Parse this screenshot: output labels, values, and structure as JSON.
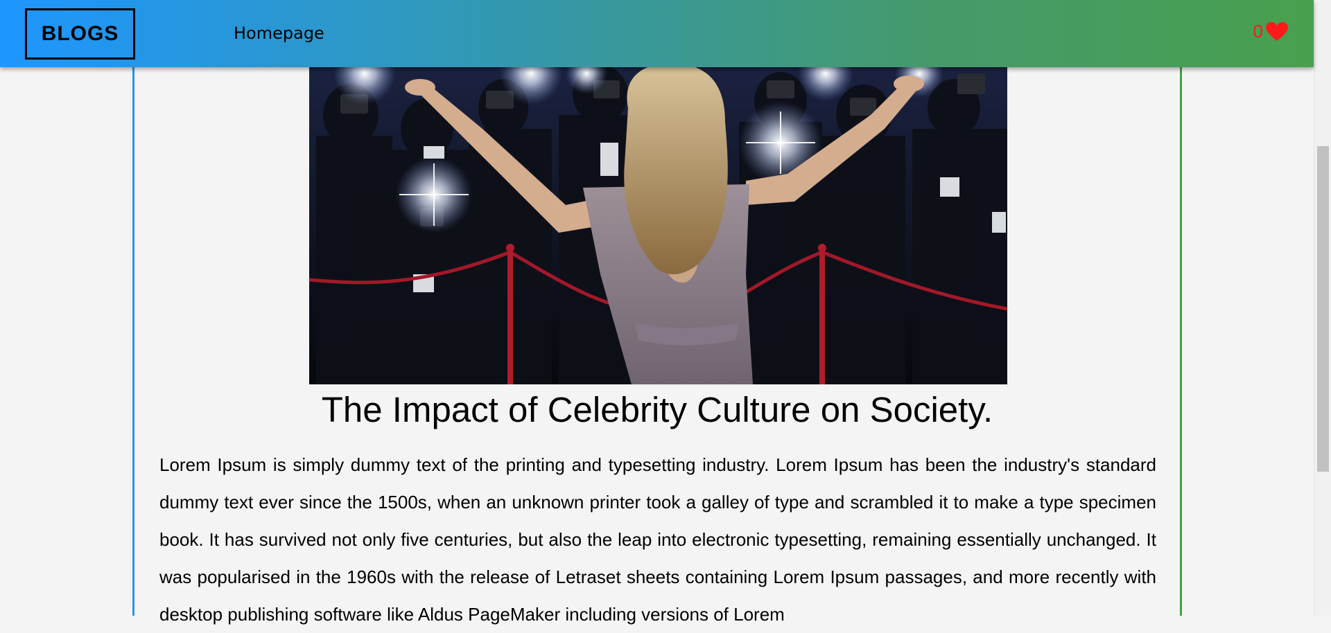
{
  "header": {
    "logo": "BLOGS",
    "nav": [
      {
        "label": "Homepage"
      }
    ],
    "likes_count": "0",
    "accent_gradient": [
      "#1e96ff",
      "#48a04e"
    ],
    "heart_color": "#ff1a1a"
  },
  "article": {
    "image_icon": "celebrity-red-carpet-photo",
    "title": "The Impact of Celebrity Culture on Society.",
    "body": "Lorem Ipsum is simply dummy text of the printing and typesetting industry. Lorem Ipsum has been the industry's standard dummy text ever since the 1500s, when an unknown printer took a galley of type and scrambled it to make a type specimen book. It has survived not only five centuries, but also the leap into electronic typesetting, remaining essentially unchanged. It was popularised in the 1960s with the release of Letraset sheets containing Lorem Ipsum passages, and more recently with desktop publishing software like Aldus PageMaker including versions of Lorem"
  }
}
